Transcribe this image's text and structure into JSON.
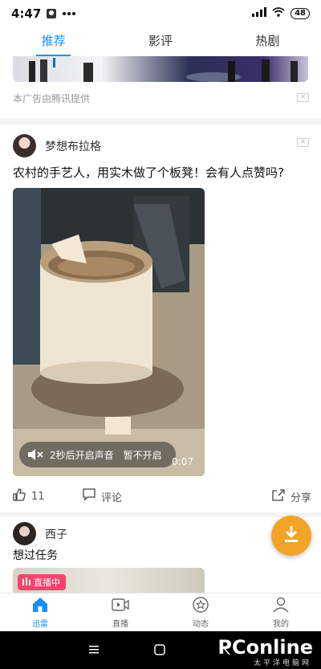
{
  "status_bar": {
    "time": "4:47",
    "battery": "48"
  },
  "tabs": [
    {
      "label": "推荐",
      "active": true
    },
    {
      "label": "影评",
      "active": false
    },
    {
      "label": "热剧",
      "active": false
    }
  ],
  "ad": {
    "note": "本广告由腾讯提供",
    "close": "×"
  },
  "post1": {
    "author": "梦想布拉格",
    "title": "农村的手艺人，用实木做了个板凳！会有人点赞吗?",
    "close": "×",
    "video": {
      "sound_tip": "2秒后开启声音",
      "sound_off": "暂不开启",
      "duration": "0:07"
    },
    "actions": {
      "likes": "11",
      "comment_label": "评论",
      "share_label": "分享"
    }
  },
  "post2": {
    "author": "西子",
    "title": "想过任务",
    "live_badge": "直播中"
  },
  "bottom_nav": [
    {
      "label": "迅雷",
      "icon": "home-icon",
      "active": true
    },
    {
      "label": "直播",
      "icon": "live-video-icon",
      "active": false
    },
    {
      "label": "动态",
      "icon": "star-circle-icon",
      "active": false
    },
    {
      "label": "我的",
      "icon": "person-icon",
      "active": false
    }
  ],
  "watermark": {
    "brand": "PConline",
    "sub": "太平洋电脑网"
  },
  "colors": {
    "accent": "#1a8ff0",
    "fab": "#f3a327",
    "live": "#f2456b"
  }
}
